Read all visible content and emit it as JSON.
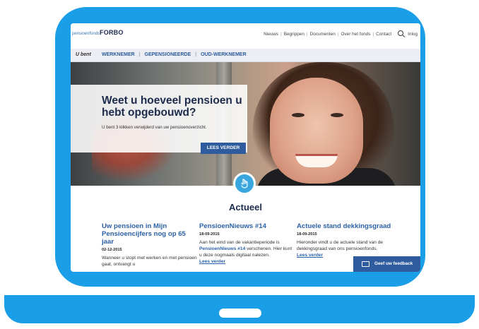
{
  "header": {
    "logo_script": "pensioenfonds",
    "logo_brand": "FORBO",
    "nav": [
      "Nieuws",
      "Begrippen",
      "Documenten",
      "Over het fonds",
      "Contact"
    ],
    "login": "Inlog"
  },
  "subnav": {
    "u_bent": "U bent",
    "items": [
      "WERKNEMER",
      "GEPENSIONEERDE",
      "OUD-WERKNEMER"
    ]
  },
  "hero": {
    "title": "Weet u hoeveel pensioen u hebt opgebouwd?",
    "subtitle": "U bent 3 klikken verwijderd van uw pensioenoverzicht.",
    "button": "LEES VERDER"
  },
  "actueel": {
    "title": "Actueel",
    "articles": [
      {
        "title": "Uw pensioen in Mijn Pensioencijfers nog op 65 jaar",
        "date": "02-12-2015",
        "body": "Wanneer u stopt met werken en met pensioen gaat, ontvangt u"
      },
      {
        "title": "PensioenNieuws #14",
        "date": "18-09-2015",
        "body_pre": "Aan het eind van de vakantieperiode is ",
        "body_bold": "PensioenNieuws #14",
        "body_post": " verschenen. Hier kunt u deze nogmaals digitaal nalezen.",
        "link": "Lees verder"
      },
      {
        "title": "Actuele stand dekkingsgraad",
        "date": "18-09-2015",
        "body": "Hieronder vindt u de actuele stand van de dekkingsgraad van ons pensioenfonds.",
        "link": "Lees verder"
      }
    ]
  },
  "feedback": "Geef uw feedback",
  "colors": {
    "frame": "#1b9ee8",
    "primary": "#2e5c9e",
    "link": "#2c62a8",
    "navy": "#1c2c4a"
  }
}
